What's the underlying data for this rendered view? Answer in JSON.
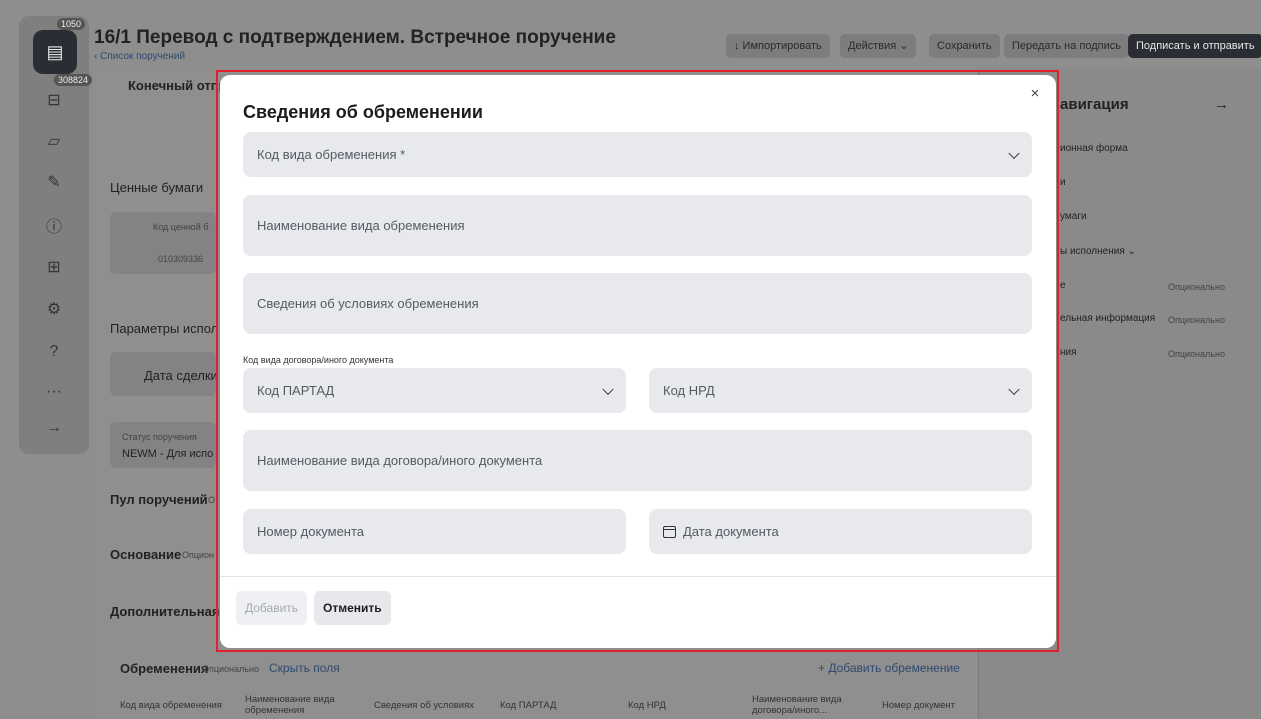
{
  "header": {
    "title": "16/1 Перевод с подтверждением. Встречное поручение",
    "breadcrumb": "‹ Список поручений",
    "buttons": {
      "import": "↓  Импортировать",
      "actions": "Действия  ⌄",
      "save": "Сохранить",
      "send_sign": "Передать на подпись",
      "sign_send": "Подписать и отправить"
    }
  },
  "rail": {
    "badge_top": "1050",
    "badge_second": "308824"
  },
  "background": {
    "final_sender": "Конечный отпр",
    "securities_title": "Ценные бумаги",
    "sec_code_header": "Код ценной б",
    "sec_code_value": "010309336",
    "exec_params": "Параметры испол",
    "deal_date": "Дата сделки",
    "status_label": "Статус поручения",
    "status_value": "NEWM - Для испо",
    "pool": "Пул поручений",
    "pool_opt": "О",
    "basis": "Основание",
    "basis_opt": "Опцион",
    "additional": "Дополнительная",
    "encumbrances": "Обременения",
    "optional": "Опционально",
    "hide_fields": "Скрыть поля",
    "add_encumbrance": "+  Добавить обременение"
  },
  "table": {
    "headers": [
      "Код вида обременения",
      "Наименование вида обременения",
      "Сведения об условиях",
      "Код ПАРТАД",
      "Код НРД",
      "Наименование вида договора/иного...",
      "Номер документ"
    ]
  },
  "nav": {
    "title": "авигация",
    "arrow": "→",
    "items": [
      {
        "label": "ионная форма",
        "opt": ""
      },
      {
        "label": "и",
        "opt": ""
      },
      {
        "label": "умаги",
        "opt": ""
      },
      {
        "label": "ы исполнения  ⌄",
        "opt": ""
      },
      {
        "label": "е",
        "opt": "Опционально"
      },
      {
        "label": "ельная информация",
        "opt": "Опционально"
      },
      {
        "label": "ния",
        "opt": "Опционально"
      }
    ]
  },
  "modal": {
    "title": "Сведения об обременении",
    "close": "×",
    "fields": {
      "encumbrance_code": "Код вида обременения *",
      "encumbrance_name": "Наименование вида обременения",
      "conditions": "Сведения об условиях обременения",
      "contract_code_label": "Код вида договора/иного документа",
      "partad_code": "Код ПАРТАД",
      "nrd_code": "Код НРД",
      "contract_name": "Наименование вида договора/иного документа",
      "doc_number": "Номер документа",
      "doc_date": "Дата документа"
    },
    "buttons": {
      "add": "Добавить",
      "cancel": "Отменить"
    }
  }
}
